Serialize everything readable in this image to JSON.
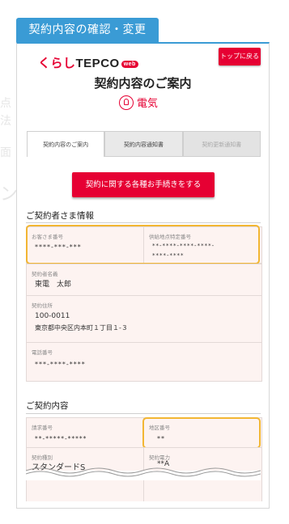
{
  "header": {
    "title": "契約内容の確認・変更"
  },
  "brand": {
    "logo_mark": "くらし",
    "logo_text": "TEPCO",
    "logo_badge": "web"
  },
  "top_button": {
    "label": "トップに戻る"
  },
  "page_title": "契約内容のご案内",
  "service": {
    "icon": "lightbulb-icon",
    "label": "電気"
  },
  "tabs": [
    {
      "label": "契約内容のご案内",
      "state": "active"
    },
    {
      "label": "契約内容通知書",
      "state": "normal"
    },
    {
      "label": "契約更新通知書",
      "state": "disabled"
    }
  ],
  "procedure_button": {
    "label": "契約に関する各種お手続きをする"
  },
  "contractor_section": {
    "title": "ご契約者さま情報",
    "customer_number": {
      "label": "お客さま番号",
      "value": "****-***-***"
    },
    "supply_point": {
      "label": "供給地点特定番号",
      "value_line1": "**-****-****-****-",
      "value_line2": "****-****"
    },
    "name": {
      "label": "契約者名義",
      "value": "東電　太郎"
    },
    "address": {
      "label": "契約住所",
      "postal": "100-0011",
      "address": "東京都中央区内本町１丁目１-３"
    },
    "phone": {
      "label": "電話番号",
      "value": "***-****-****"
    }
  },
  "contract_section": {
    "title": "ご契約内容",
    "bill_number": {
      "label": "請求番号",
      "value": "**-*****-*****"
    },
    "area_number": {
      "label": "地区番号",
      "value": "**"
    },
    "contract_type": {
      "label": "契約種別",
      "value": "スタンダードS"
    },
    "contract_power": {
      "label": "契約電力",
      "value": "**A"
    }
  },
  "colors": {
    "accent": "#e60033",
    "header_blue": "#3a9bd5",
    "highlight": "#f2b633",
    "card_bg": "#fdf3f1"
  }
}
